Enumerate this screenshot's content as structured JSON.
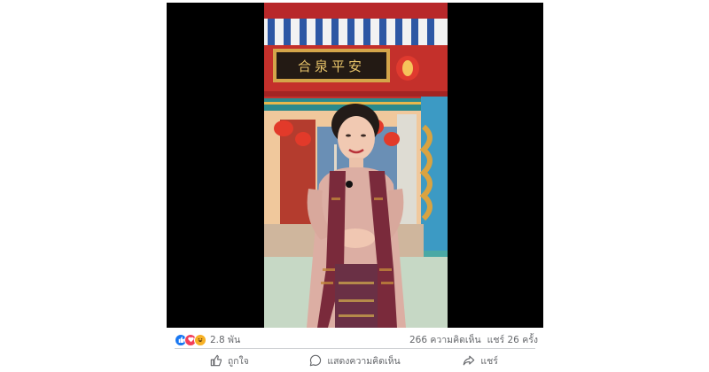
{
  "stats": {
    "reaction_count": "2.8 พัน",
    "comments": "266 ความคิดเห็น",
    "shares": "แชร์ 26 ครั้ง"
  },
  "actions": {
    "like": "ถูกใจ",
    "comment": "แสดงความคิดเห็น",
    "share": "แชร์"
  },
  "video": {
    "signboard_text": "合泉平安"
  },
  "colors": {
    "like_blue": "#1877f2",
    "love_red": "#f33e58",
    "haha_yellow": "#f7b125",
    "text_gray": "#65676b"
  }
}
